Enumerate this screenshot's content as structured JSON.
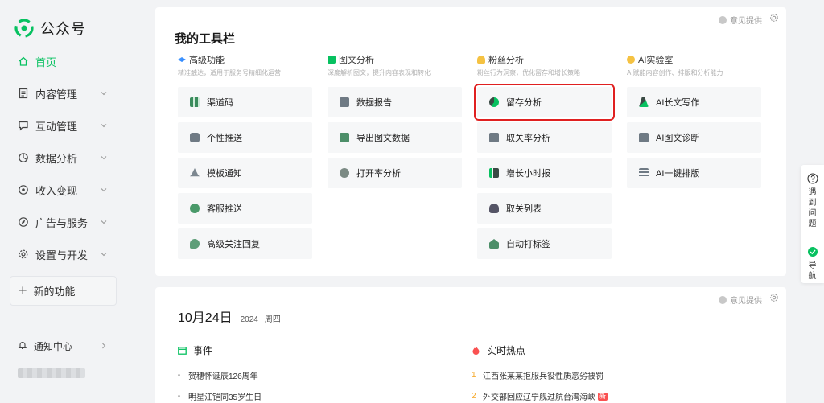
{
  "brand": {
    "name": "公众号",
    "color": "#07c160"
  },
  "sidebar": {
    "items": [
      {
        "label": "首页",
        "icon": "home-icon",
        "active": true
      },
      {
        "label": "内容管理",
        "icon": "document-icon",
        "expandable": true
      },
      {
        "label": "互动管理",
        "icon": "chat-icon",
        "expandable": true
      },
      {
        "label": "数据分析",
        "icon": "pie-chart-icon",
        "expandable": true
      },
      {
        "label": "收入变现",
        "icon": "coin-icon",
        "expandable": true
      },
      {
        "label": "广告与服务",
        "icon": "compass-icon",
        "expandable": true
      },
      {
        "label": "设置与开发",
        "icon": "gear-icon",
        "expandable": true
      }
    ],
    "new_feature": "新的功能",
    "notice": "通知中心"
  },
  "toolbar_card": {
    "feedback": "意见提供",
    "title": "我的工具栏",
    "columns": [
      {
        "title": "高级功能",
        "desc": "精准触达，适用于服务号精细化运营",
        "icon": "advanced-icon",
        "tools": [
          {
            "label": "渠道码",
            "icon": "qrcode-icon"
          },
          {
            "label": "个性推送",
            "icon": "push-icon"
          },
          {
            "label": "模板通知",
            "icon": "bell-icon"
          },
          {
            "label": "客服推送",
            "icon": "service-icon"
          },
          {
            "label": "高级关注回复",
            "icon": "reply-icon"
          }
        ]
      },
      {
        "title": "图文分析",
        "desc": "深度解析图文，提升内容表现和转化",
        "icon": "article-analysis-icon",
        "tools": [
          {
            "label": "数据报告",
            "icon": "report-icon"
          },
          {
            "label": "导出图文数据",
            "icon": "export-icon"
          },
          {
            "label": "打开率分析",
            "icon": "magnifier-icon"
          }
        ]
      },
      {
        "title": "粉丝分析",
        "desc": "粉丝行为洞察，优化留存和增长策略",
        "icon": "fans-analysis-icon",
        "tools": [
          {
            "label": "留存分析",
            "icon": "retention-icon",
            "highlighted": true
          },
          {
            "label": "取关率分析",
            "icon": "monitor-icon"
          },
          {
            "label": "增长小时报",
            "icon": "bar-chart-icon"
          },
          {
            "label": "取关列表",
            "icon": "user-list-icon"
          },
          {
            "label": "自动打标签",
            "icon": "tag-icon"
          }
        ]
      },
      {
        "title": "AI实验室",
        "desc": "AI赋能内容创作、排版和分析能力",
        "icon": "ai-lab-icon",
        "tools": [
          {
            "label": "AI长文写作",
            "icon": "pen-icon"
          },
          {
            "label": "AI图文诊断",
            "icon": "diagnosis-icon"
          },
          {
            "label": "AI一键排版",
            "icon": "layout-icon"
          }
        ]
      }
    ]
  },
  "calendar_card": {
    "feedback": "意见提供",
    "date": "10月24日",
    "year": "2024",
    "weekday": "周四",
    "events_title": "事件",
    "events": [
      "贺穗怀诞辰126周年",
      "明星江铠同35岁生日"
    ],
    "hot_title": "实时热点",
    "hot": [
      {
        "rank": "1",
        "text": "江西张某某拒服兵役性质恶劣被罚",
        "badge": ""
      },
      {
        "rank": "2",
        "text": "外交部回应辽宁舰过航台湾海峡",
        "badge": "新"
      }
    ]
  },
  "float_panel": {
    "help": "遇到问题",
    "guide": "导航"
  },
  "colors": {
    "accent": "#07c160",
    "highlight_border": "#e02020",
    "hot_rank": "#f5a623",
    "badge": "#fa5151"
  }
}
